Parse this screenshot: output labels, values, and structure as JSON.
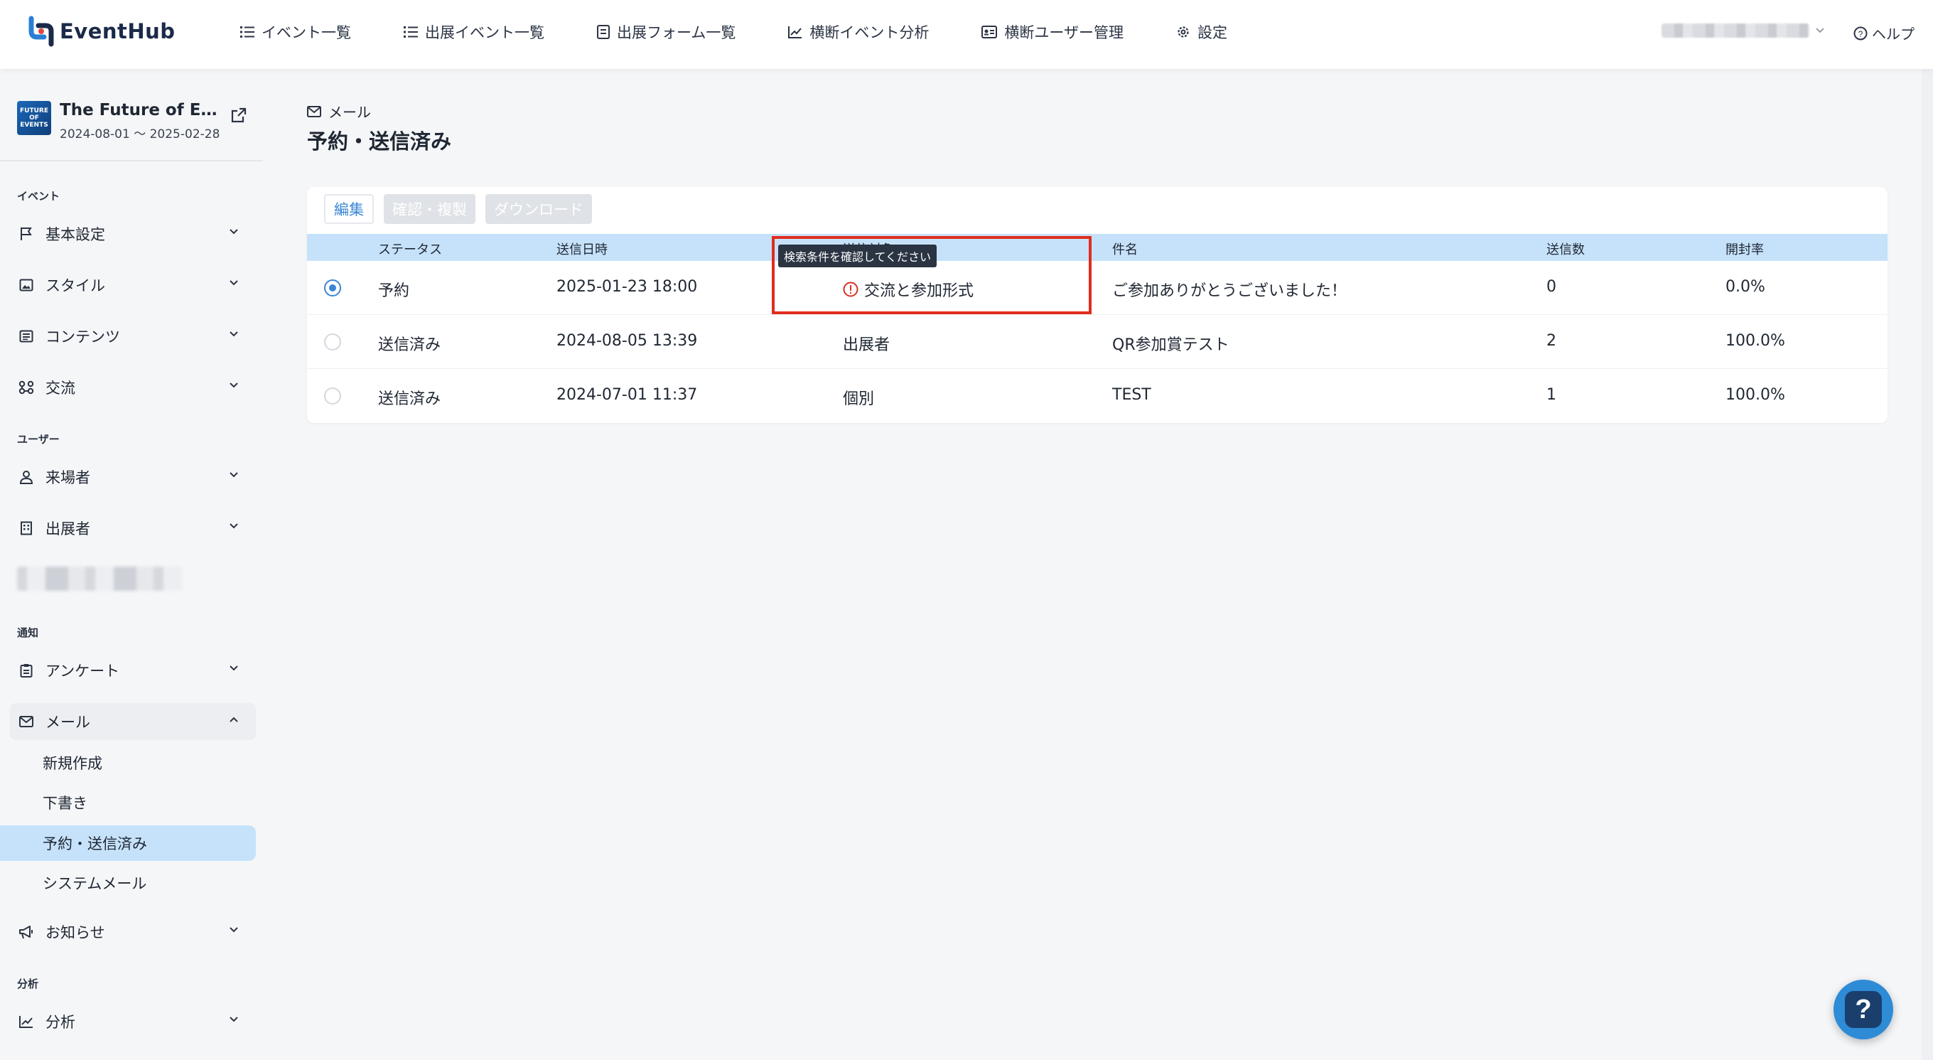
{
  "app": {
    "name": "EventHub"
  },
  "nav": [
    {
      "label": "イベント一覧",
      "icon": "list-icon"
    },
    {
      "label": "出展イベント一覧",
      "icon": "list-icon"
    },
    {
      "label": "出展フォーム一覧",
      "icon": "form-icon"
    },
    {
      "label": "横断イベント分析",
      "icon": "chart-line-icon"
    },
    {
      "label": "横断ユーザー管理",
      "icon": "id-card-icon"
    },
    {
      "label": "設定",
      "icon": "gear-icon"
    }
  ],
  "help_label": "ヘルプ",
  "event": {
    "thumb_text": "FUTURE OF EVENTS",
    "title": "The Future of Eve…",
    "dates": "2024-08-01 ～ 2025-02-28"
  },
  "sidebar": {
    "sections": {
      "event": "イベント",
      "user": "ユーザー",
      "notify": "通知",
      "analysis": "分析"
    },
    "items": {
      "basic": "基本設定",
      "style": "スタイル",
      "contents": "コンテンツ",
      "exchange": "交流",
      "visitors": "来場者",
      "exhibitors": "出展者",
      "survey": "アンケート",
      "mail": "メール",
      "news": "お知らせ",
      "analysis": "分析"
    },
    "mail_sub": {
      "new": "新規作成",
      "draft": "下書き",
      "scheduled": "予約・送信済み",
      "system": "システムメール"
    }
  },
  "breadcrumb": "メール",
  "page_title": "予約・送信済み",
  "toolbar": {
    "edit": "編集",
    "confirm_copy": "確認・複製",
    "download": "ダウンロード"
  },
  "table": {
    "headers": {
      "status": "ステータス",
      "sent_at": "送信日時",
      "target": "送信対象",
      "subject": "件名",
      "count": "送信数",
      "open_rate": "開封率"
    },
    "rows": [
      {
        "status": "予約",
        "sent_at": "2025-01-23 18:00",
        "target": "交流と参加形式",
        "subject": "ご参加ありがとうございました！",
        "count": "0",
        "open_rate": "0.0%",
        "selected": true,
        "warning": true
      },
      {
        "status": "送信済み",
        "sent_at": "2024-08-05 13:39",
        "target": "出展者",
        "subject": "QR参加賞テスト",
        "count": "2",
        "open_rate": "100.0%",
        "selected": false,
        "warning": false
      },
      {
        "status": "送信済み",
        "sent_at": "2024-07-01 11:37",
        "target": "個別",
        "subject": "TEST",
        "count": "1",
        "open_rate": "100.0%",
        "selected": false,
        "warning": false
      }
    ]
  },
  "tooltip": "検索条件を確認してください",
  "fab_label": "?",
  "colors": {
    "accent": "#3a86d6",
    "header_row": "#c6e2fa",
    "highlight": "#e02d1f",
    "warning": "#d93025"
  }
}
